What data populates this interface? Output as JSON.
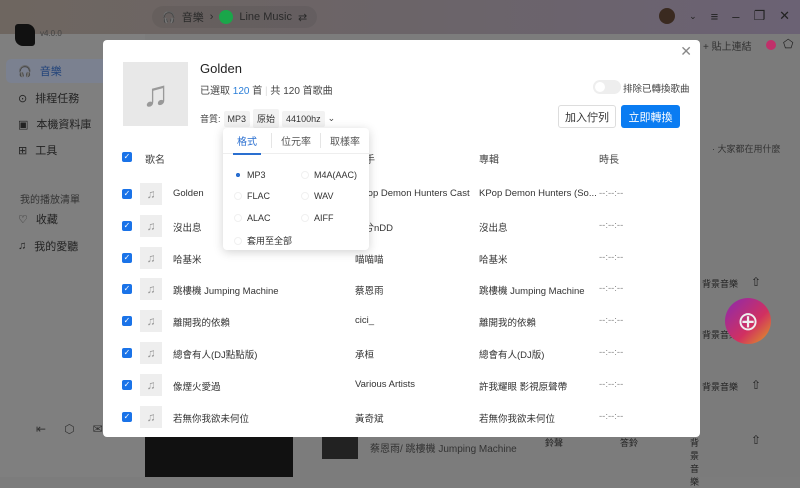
{
  "topbar": {
    "crumb_music": "音樂",
    "crumb_source": "Line Music",
    "switch_icon": "⇄"
  },
  "app": {
    "version": "v4.0.0"
  },
  "sidebar": {
    "items": [
      {
        "label": "音樂",
        "icon": "headphones-icon"
      },
      {
        "label": "排程任務",
        "icon": "download-icon"
      },
      {
        "label": "本機資料庫",
        "icon": "library-icon"
      },
      {
        "label": "工具",
        "icon": "grid-icon"
      }
    ],
    "section_title": "我的播放清單",
    "playlists": [
      {
        "label": "收藏",
        "icon": "heart-icon"
      },
      {
        "label": "我的愛聽",
        "icon": "playlist-icon"
      }
    ]
  },
  "background": {
    "paste_link": "+ 貼上連結",
    "hint_text": "· 大家都在用什麼",
    "bgm_label": "背景音樂",
    "ringtone_label": "鈴聲",
    "callring_label": "答鈴",
    "now_subtitle": "蔡恩雨/ 跳樓機 Jumping Machine"
  },
  "modal": {
    "title": "Golden",
    "selected_prefix": "已選取",
    "selected_count": "120",
    "selected_suffix": "首",
    "total_text": "共 120 首歌曲",
    "quality_label": "音質:",
    "format": "MP3",
    "bitrate": "原始",
    "samplerate": "44100hz",
    "exclude_label": "排除已轉換歌曲",
    "exclude_enabled": false,
    "queue_button": "加入佇列",
    "convert_button": "立即轉換",
    "accent_color": "#0a7cf2",
    "columns": {
      "title": "歌名",
      "artist": "歌手",
      "album": "專輯",
      "duration": "時長"
    },
    "rows": [
      {
        "title": "Golden",
        "artist": "KPop Demon Hunters Cast",
        "album": "KPop Demon Hunters (So...",
        "duration": "--:--:--"
      },
      {
        "title": "沒出息",
        "artist": "本兮nDD",
        "album": "沒出息",
        "duration": "--:--:--"
      },
      {
        "title": "哈基米",
        "artist": "喵喵喵",
        "album": "哈基米",
        "duration": "--:--:--"
      },
      {
        "title": "跳樓機 Jumping Machine",
        "artist": "蔡恩雨",
        "album": "跳樓機 Jumping Machine",
        "duration": "--:--:--"
      },
      {
        "title": "離開我的依賴",
        "artist": "cici_",
        "album": "離開我的依賴",
        "duration": "--:--:--"
      },
      {
        "title": "總會有人(DJ點點版)",
        "artist": "承桓",
        "album": "總會有人(DJ版)",
        "duration": "--:--:--"
      },
      {
        "title": "像煙火愛過",
        "artist": "Various Artists",
        "album": "許我耀眼 影視原聲帶",
        "duration": "--:--:--"
      },
      {
        "title": "若無你我欲未何位",
        "artist": "黃奇斌",
        "album": "若無你我欲未何位",
        "duration": "--:--:--"
      }
    ]
  },
  "popover": {
    "tabs": [
      "格式",
      "位元率",
      "取樣率"
    ],
    "active_tab": "格式",
    "options": [
      "MP3",
      "M4A(AAC)",
      "FLAC",
      "WAV",
      "ALAC",
      "AIFF"
    ],
    "selected": "MP3",
    "apply_all": "套用至全部"
  }
}
